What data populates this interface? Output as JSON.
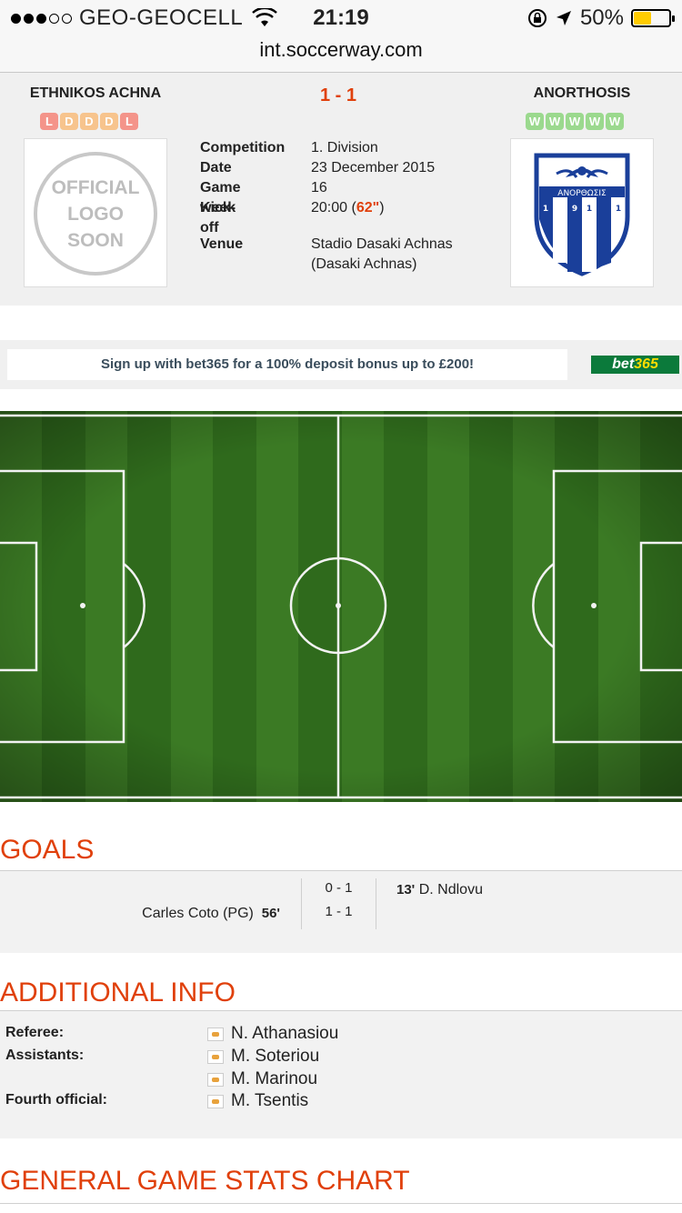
{
  "status_bar": {
    "carrier": "GEO-GEOCELL",
    "time": "21:19",
    "battery_text": "50%",
    "battery_level": 0.5,
    "signal_bars_filled": 3,
    "signal_bars_total": 5,
    "icons": [
      "wifi-icon",
      "rotation-lock-icon",
      "location-arrow-icon",
      "battery-icon"
    ]
  },
  "browser": {
    "url": "int.soccerway.com"
  },
  "match": {
    "home_team": "ETHNIKOS ACHNA",
    "away_team": "ANORTHOSIS",
    "score": "1 - 1",
    "home_form": [
      "L",
      "D",
      "D",
      "D",
      "L"
    ],
    "away_form": [
      "W",
      "W",
      "W",
      "W",
      "W"
    ],
    "home_logo_text": [
      "OFFICIAL",
      "LOGO",
      "SOON"
    ],
    "away_logo_text": "ΑΝΟΡΘΩΣΙΣ",
    "away_logo_year": [
      "1",
      "9",
      "1",
      "1"
    ],
    "details": {
      "competition_label": "Competition",
      "competition": "1. Division",
      "date_label": "Date",
      "date": "23 December 2015",
      "gameweek_label": "Game week",
      "gameweek": "16",
      "kickoff_label": "Kick-off",
      "kickoff_time": "20:00",
      "kickoff_live": "62\"",
      "venue_label": "Venue",
      "venue_line1": "Stadio Dasaki Achnas",
      "venue_line2": "(Dasaki Achnas)"
    }
  },
  "ad": {
    "text": "Sign up with bet365 for a 100% deposit bonus up to £200!",
    "brand_a": "bet",
    "brand_b": "365"
  },
  "goals": {
    "title": "GOALS",
    "events": [
      {
        "score": "0 - 1",
        "away_minute": "13'",
        "away_player": "D. Ndlovu"
      },
      {
        "score": "1 - 1",
        "home_player": "Carles Coto (PG)",
        "home_minute": "56'"
      }
    ]
  },
  "additional_info": {
    "title": "ADDITIONAL INFO",
    "referee_label": "Referee:",
    "referee": "N. Athanasiou",
    "assistants_label": "Assistants:",
    "assistant_1": "M. Soteriou",
    "assistant_2": "M. Marinou",
    "fourth_label": "Fourth official:",
    "fourth": "M. Tsentis"
  },
  "stats_chart": {
    "title": "GENERAL GAME STATS CHART"
  },
  "colors": {
    "accent": "#e0400b",
    "form_loss": "#f4948a",
    "form_draw": "#f7c48d",
    "form_win": "#9bd98e",
    "pitch_dark": "#2f6a1c",
    "pitch_light": "#3d7d24"
  }
}
